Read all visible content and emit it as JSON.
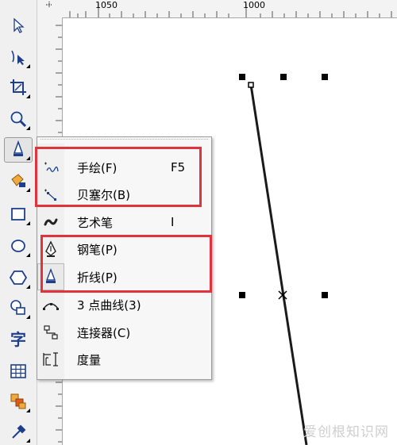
{
  "ruler": {
    "top_labels": [
      "1050",
      "1000"
    ]
  },
  "menu": {
    "items": [
      {
        "label": "手绘(F)",
        "shortcut": "F5",
        "icon": "freehand-icon"
      },
      {
        "label": "贝塞尔(B)",
        "shortcut": "",
        "icon": "bezier-icon"
      },
      {
        "label": "艺术笔",
        "shortcut": "I",
        "icon": "artistic-media-icon"
      },
      {
        "label": "钢笔(P)",
        "shortcut": "",
        "icon": "pen-icon"
      },
      {
        "label": "折线(P)",
        "shortcut": "",
        "icon": "polyline-icon"
      },
      {
        "label": "3 点曲线(3)",
        "shortcut": "",
        "icon": "three-point-curve-icon"
      },
      {
        "label": "连接器(C)",
        "shortcut": "",
        "icon": "connector-icon"
      },
      {
        "label": "度量",
        "shortcut": "",
        "icon": "dimension-icon"
      }
    ]
  },
  "toolbox": {
    "text_tool_glyph": "字"
  },
  "colors": {
    "highlight_box": "#e0333c",
    "line": "#1a1a1a"
  },
  "watermark": "爱创根知识网"
}
